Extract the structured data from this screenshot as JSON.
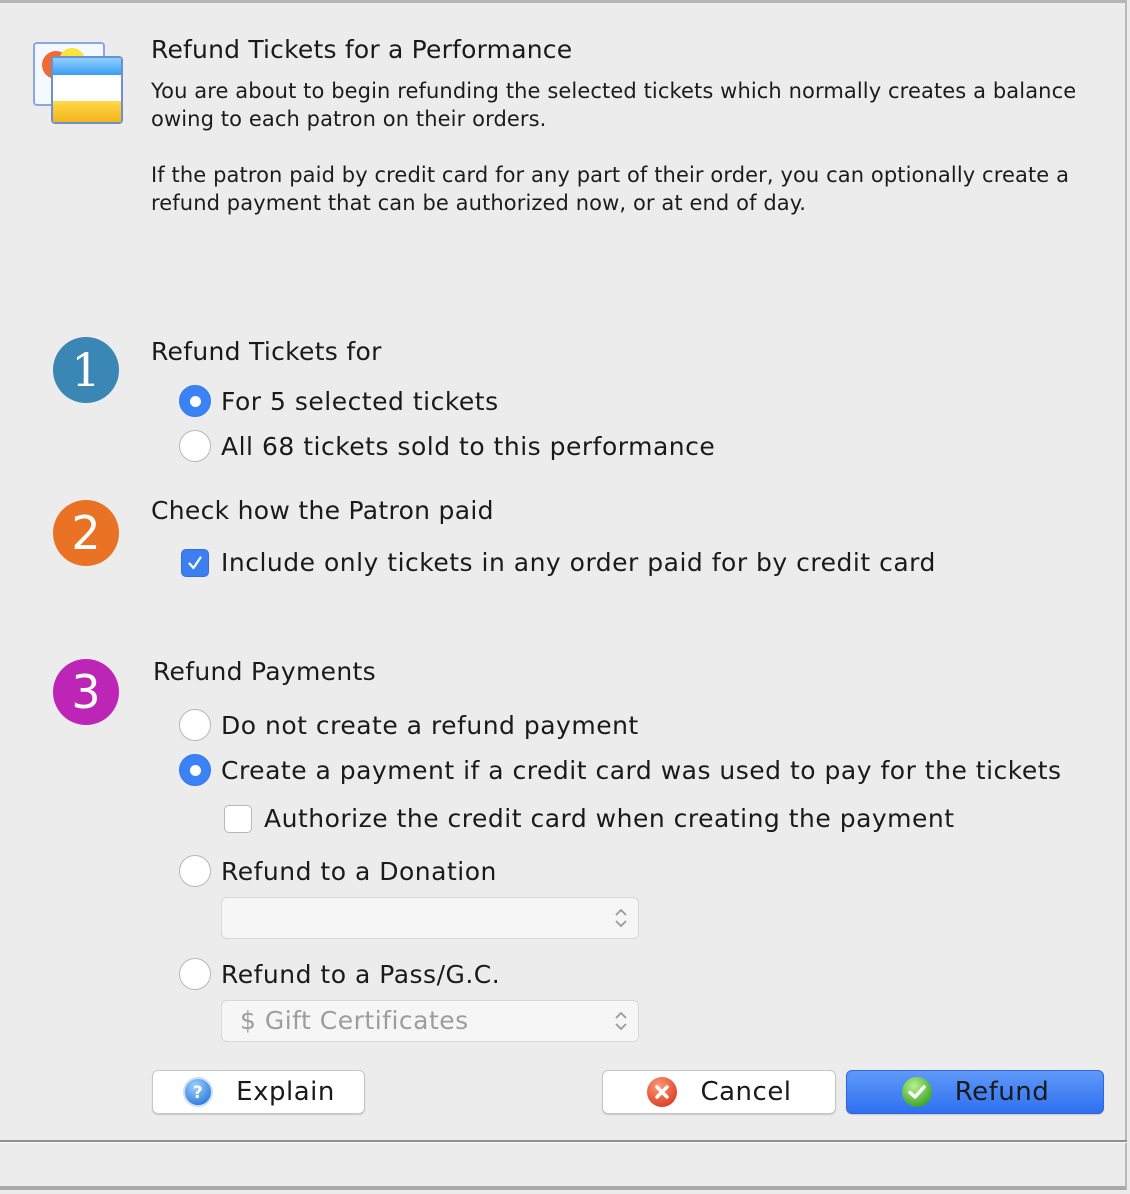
{
  "header": {
    "icon": "refund-tickets-app-icon",
    "title": "Refund Tickets for a Performance",
    "paragraph1": "You are about to begin refunding the selected tickets which normally creates a balance owing to each patron on their orders.",
    "paragraph2": "If the patron paid by credit card for any part of their order, you can optionally create a refund payment that can be authorized now, or at end of day."
  },
  "steps": [
    {
      "number": "1",
      "color": "#3a86b4",
      "title": "Refund Tickets for",
      "options": [
        {
          "label": "For 5 selected tickets",
          "type": "radio",
          "checked": true
        },
        {
          "label": "All 68 tickets sold to this performance",
          "type": "radio",
          "checked": false
        }
      ]
    },
    {
      "number": "2",
      "color": "#ea7224",
      "title": "Check how the Patron paid",
      "options": [
        {
          "label": "Include only tickets in any order paid for by credit card",
          "type": "checkbox",
          "checked": true
        }
      ]
    },
    {
      "number": "3",
      "color": "#bd25b6",
      "title": "Refund Payments",
      "options": [
        {
          "label": "Do not create a refund payment",
          "type": "radio",
          "checked": false
        },
        {
          "label": "Create a payment if a credit card was used to pay for the tickets",
          "type": "radio",
          "checked": true
        },
        {
          "label": "Authorize the credit card when creating the payment",
          "type": "checkbox",
          "checked": false
        },
        {
          "label": "Refund to a Donation",
          "type": "radio",
          "checked": false
        },
        {
          "label": "Refund to a Pass/G.C.",
          "type": "radio",
          "checked": false
        }
      ],
      "donation_select": {
        "value": "",
        "disabled": true
      },
      "pass_select": {
        "value": "$ Gift Certificates",
        "disabled": true
      }
    }
  ],
  "buttons": {
    "explain": {
      "label": "Explain",
      "icon": "help-icon"
    },
    "cancel": {
      "label": "Cancel",
      "icon": "cancel-icon"
    },
    "refund": {
      "label": "Refund",
      "icon": "checkmark-icon",
      "color": "#3b7cf4"
    }
  }
}
